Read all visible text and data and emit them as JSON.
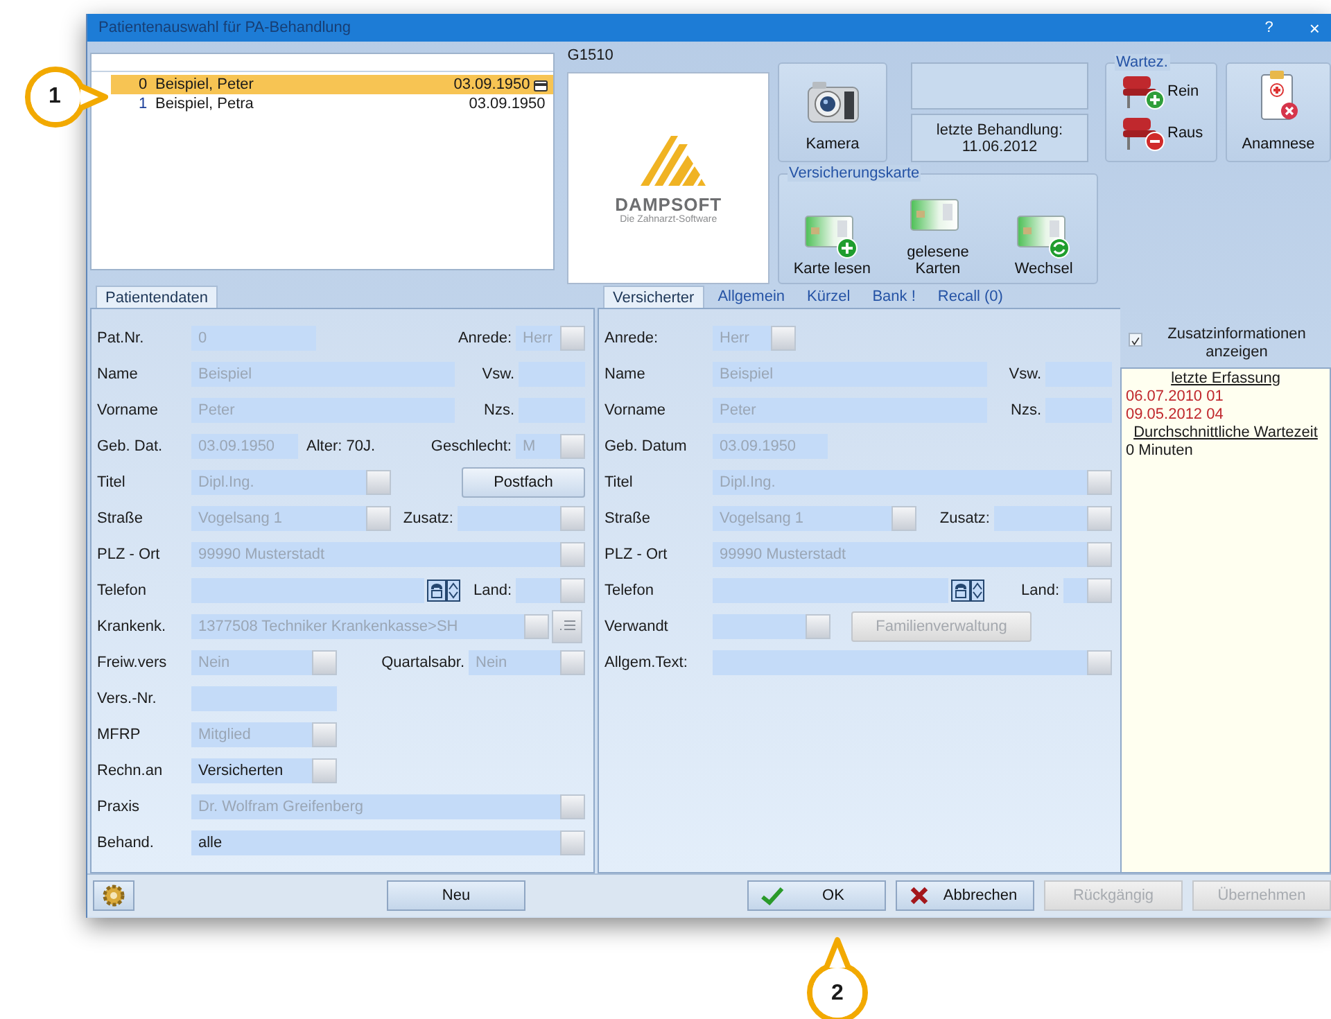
{
  "window": {
    "title": "Patientenauswahl für PA-Behandlung",
    "controls": [
      {
        "kind": "help",
        "label": "?"
      },
      {
        "kind": "close",
        "label": "×"
      }
    ]
  },
  "patient_list": {
    "rows": [
      {
        "number": "0",
        "name": "Beispiel, Peter",
        "birth_date": "03.09.1950",
        "selected": true,
        "card": true
      },
      {
        "number": "1",
        "name": "Beispiel, Petra",
        "birth_date": "03.09.1950",
        "selected": false,
        "card": false
      }
    ]
  },
  "practice_code": "G1510",
  "logo": {
    "name": "DAMPSOFT",
    "tagline": "Die Zahnarzt-Software"
  },
  "camera_button": {
    "label": "Kamera"
  },
  "treatment_info": {
    "label": "letzte Behandlung:",
    "date": "11.06.2012"
  },
  "waiting_room": {
    "title": "Wartez.",
    "buttons": [
      {
        "kind": "in",
        "label": "Rein"
      },
      {
        "kind": "out",
        "label": "Raus"
      }
    ]
  },
  "anamnesis_button": {
    "label": "Anamnese"
  },
  "insurance_card": {
    "title": "Versicherungskarte",
    "buttons": [
      {
        "kind": "read",
        "label": "Karte lesen"
      },
      {
        "kind": "list",
        "label": "gelesene Karten"
      },
      {
        "kind": "change",
        "label": "Wechsel"
      }
    ]
  },
  "patient_panel": {
    "tabs": [
      {
        "label": "Patientendaten",
        "selected": true
      }
    ],
    "rows": [
      {
        "items": [
          {
            "kind": "label",
            "text": "Pat.Nr."
          },
          {
            "kind": "field",
            "value": "0",
            "disabled": true
          },
          {
            "kind": "label",
            "text": "Anrede:"
          },
          {
            "kind": "select",
            "value": "Herr",
            "disabled": true
          }
        ]
      },
      {
        "items": [
          {
            "kind": "label",
            "text": "Name"
          },
          {
            "kind": "field",
            "value": "Beispiel",
            "disabled": true
          },
          {
            "kind": "label",
            "text": "Vsw."
          },
          {
            "kind": "field"
          }
        ]
      },
      {
        "items": [
          {
            "kind": "label",
            "text": "Vorname"
          },
          {
            "kind": "field",
            "value": "Peter",
            "disabled": true
          },
          {
            "kind": "label",
            "text": "Nzs."
          },
          {
            "kind": "field"
          }
        ]
      },
      {
        "items": [
          {
            "kind": "label",
            "text": "Geb. Dat."
          },
          {
            "kind": "field",
            "value": "03.09.1950",
            "disabled": true
          },
          {
            "kind": "text",
            "text": "Alter: 70J."
          },
          {
            "kind": "label",
            "text": "Geschlecht:"
          },
          {
            "kind": "select",
            "value": "M",
            "disabled": true
          }
        ]
      },
      {
        "items": [
          {
            "kind": "label",
            "text": "Titel"
          },
          {
            "kind": "select",
            "value": "Dipl.Ing.",
            "disabled": true
          },
          {
            "kind": "button",
            "label": "Postfach",
            "disabled": false
          }
        ]
      },
      {
        "items": [
          {
            "kind": "label",
            "text": "Straße"
          },
          {
            "kind": "select",
            "value": "Vogelsang 1",
            "disabled": true
          },
          {
            "kind": "label",
            "text": "Zusatz:"
          },
          {
            "kind": "select"
          }
        ]
      },
      {
        "items": [
          {
            "kind": "label",
            "text": "PLZ - Ort"
          },
          {
            "kind": "select",
            "value": "99990 Musterstadt",
            "disabled": true
          }
        ]
      },
      {
        "items": [
          {
            "kind": "label",
            "text": "Telefon"
          },
          {
            "kind": "field"
          },
          {
            "kind": "phone"
          },
          {
            "kind": "label",
            "text": "Land:"
          },
          {
            "kind": "select"
          }
        ]
      },
      {
        "items": [
          {
            "kind": "label",
            "text": "Krankenk."
          },
          {
            "kind": "select",
            "value": "1377508 Techniker Krankenkasse>SH",
            "disabled": true
          },
          {
            "kind": "picker"
          }
        ]
      },
      {
        "items": [
          {
            "kind": "label",
            "text": "Freiw.vers"
          },
          {
            "kind": "select",
            "value": "Nein",
            "disabled": true
          },
          {
            "kind": "label",
            "text": "Quartalsabr."
          },
          {
            "kind": "select",
            "value": "Nein",
            "disabled": true
          }
        ]
      },
      {
        "items": [
          {
            "kind": "label",
            "text": "Vers.-Nr."
          },
          {
            "kind": "field"
          }
        ]
      },
      {
        "items": [
          {
            "kind": "label",
            "text": "MFRP"
          },
          {
            "kind": "select",
            "value": "Mitglied",
            "disabled": true
          }
        ]
      },
      {
        "items": [
          {
            "kind": "label",
            "text": "Rechn.an"
          },
          {
            "kind": "select",
            "value": "Versicherten",
            "disabled": false
          }
        ]
      },
      {
        "items": [
          {
            "kind": "label",
            "text": "Praxis"
          },
          {
            "kind": "select",
            "value": "Dr. Wolfram Greifenberg",
            "disabled": true
          }
        ]
      },
      {
        "items": [
          {
            "kind": "label",
            "text": "Behand."
          },
          {
            "kind": "select",
            "value": "alle",
            "disabled": false
          }
        ]
      }
    ]
  },
  "insured_panel": {
    "tabs": [
      {
        "label": "Versicherter",
        "selected": true
      },
      {
        "label": "Allgemein",
        "selected": false
      },
      {
        "label": "Kürzel",
        "selected": false
      },
      {
        "label": "Bank !",
        "selected": false
      },
      {
        "label": "Recall (0)",
        "selected": false
      }
    ],
    "rows": [
      {
        "items": [
          {
            "kind": "label",
            "text": "Anrede:"
          },
          {
            "kind": "select",
            "value": "Herr",
            "disabled": true
          }
        ]
      },
      {
        "items": [
          {
            "kind": "label",
            "text": "Name"
          },
          {
            "kind": "field",
            "value": "Beispiel",
            "disabled": true
          },
          {
            "kind": "label",
            "text": "Vsw."
          },
          {
            "kind": "field"
          }
        ]
      },
      {
        "items": [
          {
            "kind": "label",
            "text": "Vorname"
          },
          {
            "kind": "field",
            "value": "Peter",
            "disabled": true
          },
          {
            "kind": "label",
            "text": "Nzs."
          },
          {
            "kind": "field"
          }
        ]
      },
      {
        "items": [
          {
            "kind": "label",
            "text": "Geb. Datum"
          },
          {
            "kind": "field",
            "value": "03.09.1950",
            "disabled": true
          }
        ]
      },
      {
        "items": [
          {
            "kind": "label",
            "text": "Titel"
          },
          {
            "kind": "select",
            "value": "Dipl.Ing.",
            "disabled": true
          }
        ]
      },
      {
        "items": [
          {
            "kind": "label",
            "text": "Straße"
          },
          {
            "kind": "select",
            "value": "Vogelsang 1",
            "disabled": true
          },
          {
            "kind": "label",
            "text": "Zusatz:"
          },
          {
            "kind": "select"
          }
        ]
      },
      {
        "items": [
          {
            "kind": "label",
            "text": "PLZ - Ort"
          },
          {
            "kind": "select",
            "value": "99990 Musterstadt",
            "disabled": true
          }
        ]
      },
      {
        "items": [
          {
            "kind": "label",
            "text": "Telefon"
          },
          {
            "kind": "field"
          },
          {
            "kind": "phone"
          },
          {
            "kind": "label",
            "text": "Land:"
          },
          {
            "kind": "select"
          }
        ]
      },
      {
        "items": [
          {
            "kind": "label",
            "text": "Verwandt"
          },
          {
            "kind": "select"
          },
          {
            "kind": "button",
            "label": "Familienverwaltung",
            "disabled": true
          }
        ]
      },
      {
        "items": [
          {
            "kind": "label",
            "text": "Allgem.Text:"
          },
          {
            "kind": "select"
          }
        ]
      }
    ]
  },
  "extra_info": {
    "label": "Zusatzinformationen anzeigen",
    "checked": true,
    "items": [
      {
        "kind": "heading",
        "text": "letzte Erfassung"
      },
      {
        "kind": "date",
        "text": "06.07.2010 01"
      },
      {
        "kind": "date",
        "text": "09.05.2012 04"
      },
      {
        "kind": "heading",
        "text": "Durchschnittliche Wartezeit"
      },
      {
        "kind": "text",
        "text": "0 Minuten"
      }
    ]
  },
  "footer": {
    "buttons": [
      {
        "kind": "settings",
        "disabled": false
      },
      {
        "kind": "plain",
        "label": "Neu",
        "disabled": false
      },
      {
        "kind": "ok",
        "label": "OK",
        "disabled": false
      },
      {
        "kind": "cancel",
        "label": "Abbrechen",
        "disabled": false
      },
      {
        "kind": "plain",
        "label": "Rückgängig",
        "disabled": true
      },
      {
        "kind": "plain",
        "label": "Übernehmen",
        "disabled": true
      }
    ]
  },
  "callouts": [
    {
      "number": "1"
    },
    {
      "number": "2"
    }
  ]
}
